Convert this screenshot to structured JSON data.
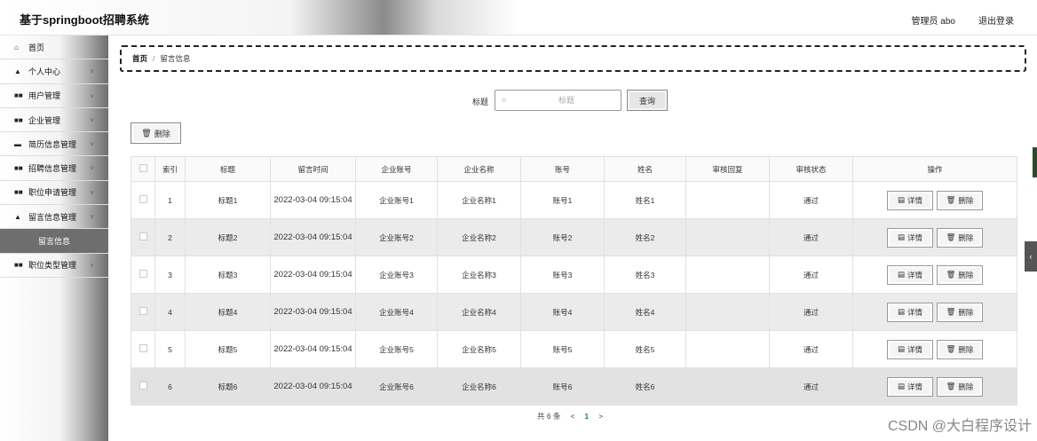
{
  "header": {
    "title": "基于springboot招聘系统",
    "user": "管理员 abo",
    "logout": "退出登录"
  },
  "sidebar": {
    "items": [
      {
        "label": "首页",
        "icon": "home-icon"
      },
      {
        "label": "个人中心",
        "icon": "user-icon"
      },
      {
        "label": "用户管理",
        "icon": "grid-icon"
      },
      {
        "label": "企业管理",
        "icon": "grid-icon"
      },
      {
        "label": "简历信息管理",
        "icon": "monitor-icon"
      },
      {
        "label": "招聘信息管理",
        "icon": "grid-icon"
      },
      {
        "label": "职位申请管理",
        "icon": "grid-icon"
      },
      {
        "label": "留言信息管理",
        "icon": "user-icon"
      }
    ],
    "sub_active": "留言信息",
    "last_item": {
      "label": "职位类型管理",
      "icon": "grid-icon"
    }
  },
  "breadcrumb": {
    "home": "首页",
    "sep": "/",
    "current": "留言信息"
  },
  "search": {
    "label": "标题",
    "placeholder": "标题",
    "button": "查询"
  },
  "toolbar": {
    "delete": "删除"
  },
  "table": {
    "headers": [
      "索引",
      "标题",
      "留言时间",
      "企业账号",
      "企业名称",
      "账号",
      "姓名",
      "审核回复",
      "审核状态",
      "操作"
    ],
    "detail_label": "详情",
    "delete_label": "删除",
    "rows": [
      {
        "idx": "1",
        "title": "标题1",
        "time": "2022-03-04 09:15:04",
        "corp_acct": "企业账号1",
        "corp_name": "企业名称1",
        "acct": "账号1",
        "name": "姓名1",
        "reply": "",
        "status": "通过"
      },
      {
        "idx": "2",
        "title": "标题2",
        "time": "2022-03-04 09:15:04",
        "corp_acct": "企业账号2",
        "corp_name": "企业名称2",
        "acct": "账号2",
        "name": "姓名2",
        "reply": "",
        "status": "通过"
      },
      {
        "idx": "3",
        "title": "标题3",
        "time": "2022-03-04 09:15:04",
        "corp_acct": "企业账号3",
        "corp_name": "企业名称3",
        "acct": "账号3",
        "name": "姓名3",
        "reply": "",
        "status": "通过"
      },
      {
        "idx": "4",
        "title": "标题4",
        "time": "2022-03-04 09:15:04",
        "corp_acct": "企业账号4",
        "corp_name": "企业名称4",
        "acct": "账号4",
        "name": "姓名4",
        "reply": "",
        "status": "通过"
      },
      {
        "idx": "5",
        "title": "标题5",
        "time": "2022-03-04 09:15:04",
        "corp_acct": "企业账号5",
        "corp_name": "企业名称5",
        "acct": "账号5",
        "name": "姓名5",
        "reply": "",
        "status": "通过"
      },
      {
        "idx": "6",
        "title": "标题6",
        "time": "2022-03-04 09:15:04",
        "corp_acct": "企业账号6",
        "corp_name": "企业名称6",
        "acct": "账号6",
        "name": "姓名6",
        "reply": "",
        "status": "通过"
      }
    ]
  },
  "pagination": {
    "total": "共 6 条",
    "prev": "<",
    "page": "1",
    "next": ">"
  },
  "watermark": "CSDN @大白程序设计",
  "colors": {
    "pager_active": "#1a8a3a",
    "sidebar_active": "#6e6e6e"
  }
}
